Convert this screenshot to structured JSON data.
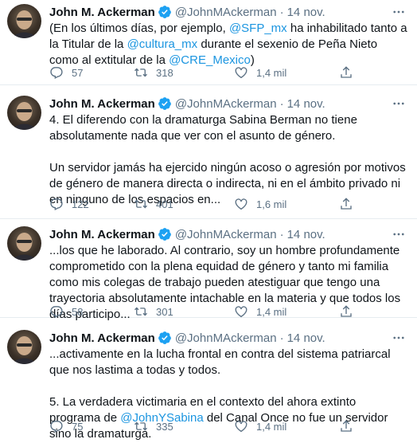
{
  "tweets": [
    {
      "name": "John M. Ackerman",
      "handle": "@JohnMAckerman",
      "dot": "·",
      "time": "14 nov.",
      "body_pre": "(En los últimos días, por ejemplo, ",
      "mention1": "@SFP_mx",
      "body_mid1": "  ha inhabilitado tanto a la Titular de la ",
      "mention2": "@cultura_mx",
      "body_mid2": " durante el sexenio de Peña Nieto como al extitular de la ",
      "mention3": "@CRE_Mexico",
      "body_post": ")",
      "replies": "57",
      "retweets": "318",
      "likes": "1,4 mil"
    },
    {
      "name": "John M. Ackerman",
      "handle": "@JohnMAckerman",
      "dot": "·",
      "time": "14 nov.",
      "para1": "4. El diferendo con la dramaturga Sabina Berman no tiene absolutamente nada que ver con el asunto de género.",
      "para2": "Un servidor jamás ha ejercido ningún acoso o agresión por motivos de género de manera directa o indirecta, ni en el ámbito privado ni en ninguno de los espacios en...",
      "replies": "122",
      "retweets": "401",
      "likes": "1,6 mil"
    },
    {
      "name": "John M. Ackerman",
      "handle": "@JohnMAckerman",
      "dot": "·",
      "time": "14 nov.",
      "para1": "...los que he laborado. Al contrario, soy un hombre profundamente comprometido con la plena equidad de género y tanto mi familia como mis colegas de trabajo pueden atestiguar que tengo una trayectoria absolutamente intachable en la materia y que todos los días participo...",
      "replies": "58",
      "retweets": "301",
      "likes": "1,4 mil"
    },
    {
      "name": "John M. Ackerman",
      "handle": "@JohnMAckerman",
      "dot": "·",
      "time": "14 nov.",
      "para1": "...activamente en la lucha frontal en contra del sistema patriarcal que nos lastima a todas y todos.",
      "para2_pre": "5. La verdadera victimaria en el contexto del ahora extinto programa de ",
      "mention1": "@JohnYSabina",
      "para2_post": " del Canal Once no fue un servidor sino la dramaturga.",
      "replies": "75",
      "retweets": "335",
      "likes": "1,4 mil"
    }
  ],
  "colors": {
    "link": "#1b95e0",
    "verified": "#1da1f2",
    "muted": "#5b7083",
    "divider": "#e6ecf0"
  },
  "icons": [
    "avatar",
    "verified-icon",
    "more-icon",
    "reply-icon",
    "retweet-icon",
    "like-icon",
    "share-icon"
  ]
}
